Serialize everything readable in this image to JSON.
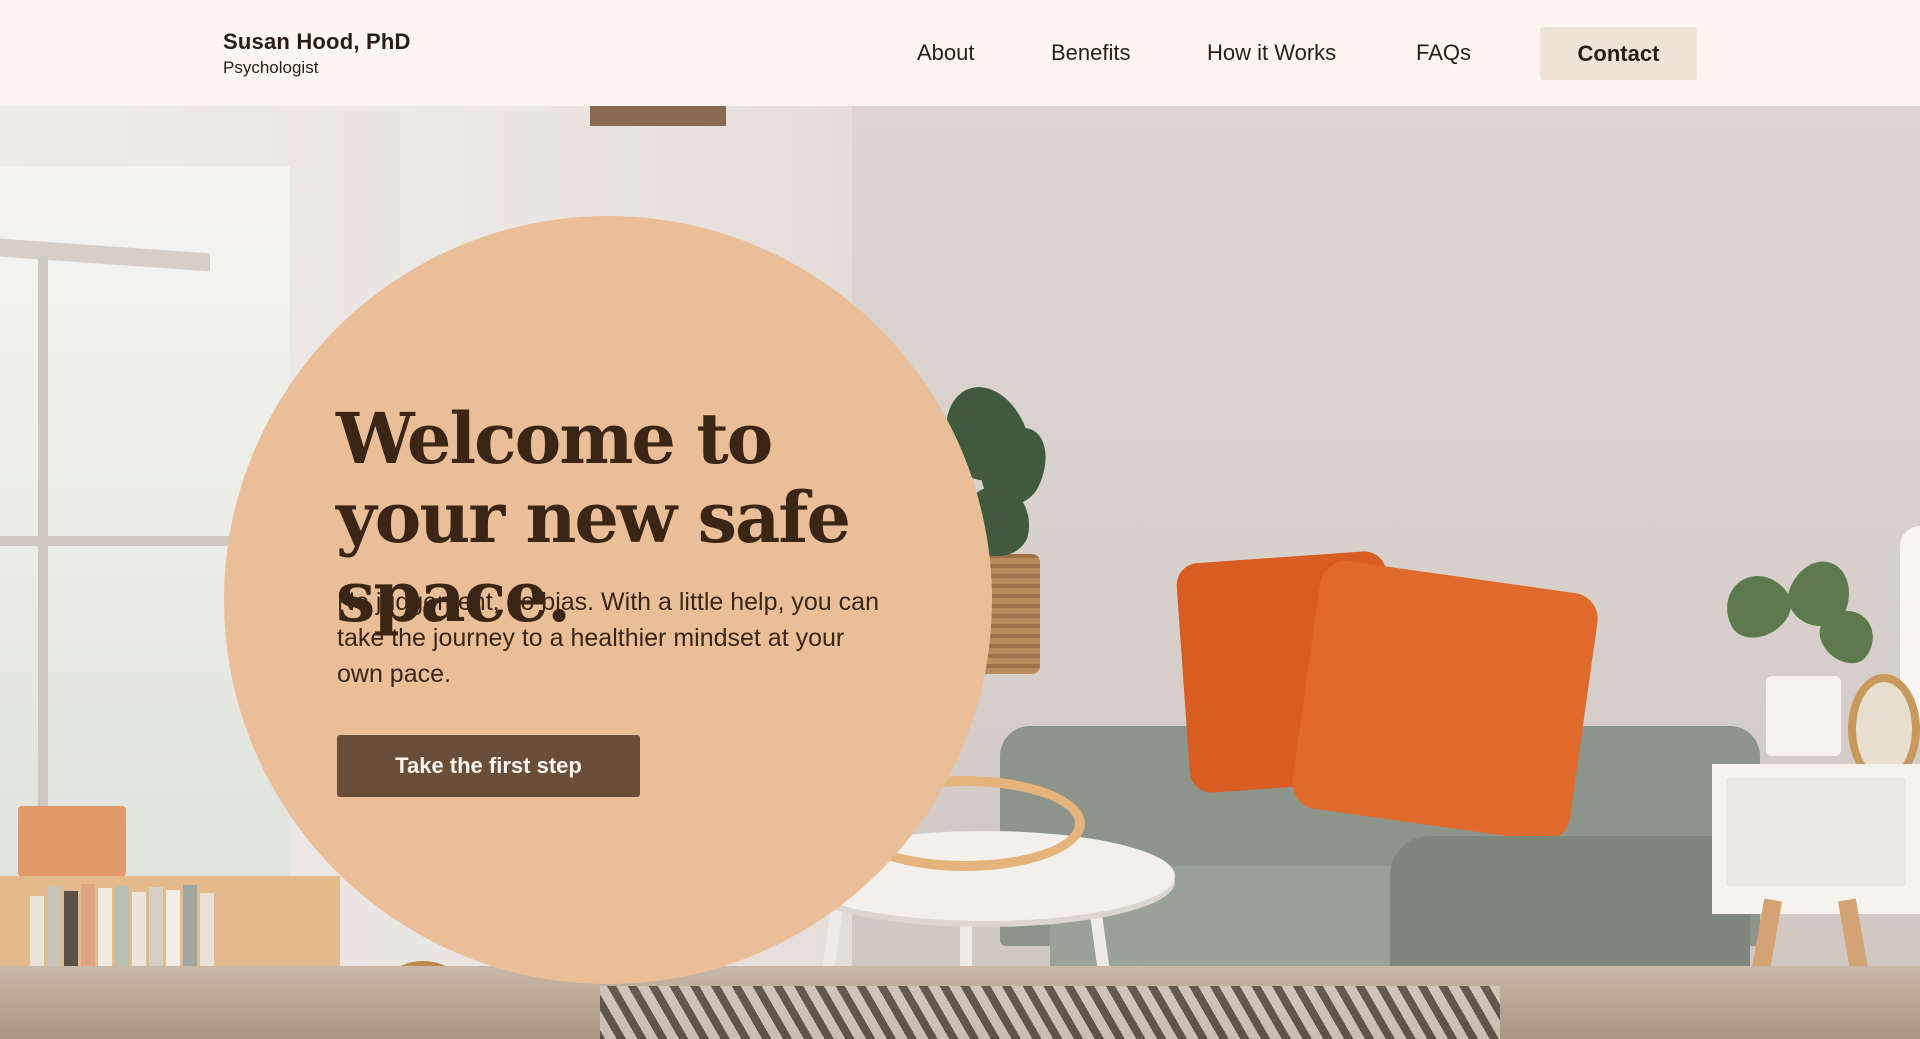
{
  "brand": {
    "name": "Susan Hood, PhD",
    "role": "Psychologist"
  },
  "nav": {
    "items": [
      "About",
      "Benefits",
      "How it Works",
      "FAQs"
    ],
    "contact_label": "Contact"
  },
  "hero": {
    "headline": "Welcome to your new safe space.",
    "subtext": "No judgement, no bias. With a little help, you can take the journey to a healthier mindset at your own pace.",
    "cta_label": "Take the first step"
  },
  "colors": {
    "page_bg": "#fdf6f0",
    "circle": "#eabf97",
    "cta": "#6b4e38",
    "contact_bg": "#efe2d6",
    "text_dark": "#3b2616"
  }
}
